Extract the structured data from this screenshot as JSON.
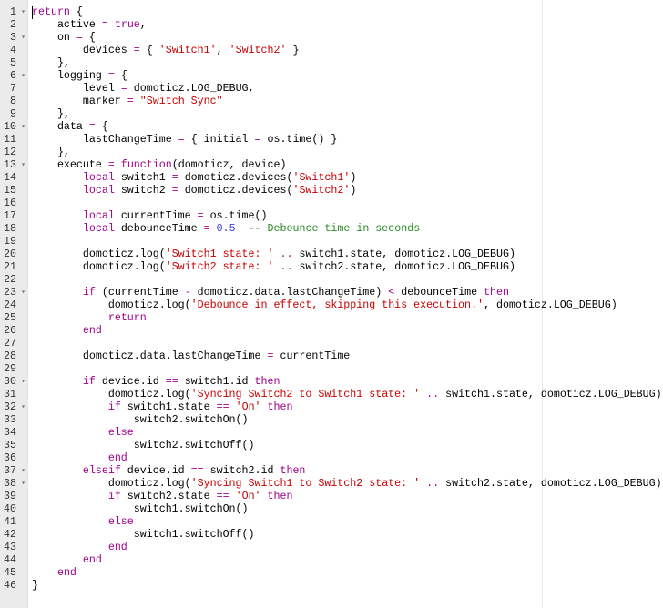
{
  "editor": {
    "accent_colors": {
      "keyword": "#a0008c",
      "string": "#c80000",
      "comment": "#2a8a24",
      "number": "#3c3ccf"
    },
    "fold_icon": "caret-down-icon",
    "fold_lines": [
      1,
      3,
      6,
      10,
      13,
      23,
      30,
      32,
      37,
      38
    ],
    "lines": [
      [
        [
          "k",
          "return"
        ],
        [
          "p",
          " {"
        ]
      ],
      [
        [
          "p",
          "    active "
        ],
        [
          "o",
          "="
        ],
        [
          "p",
          " "
        ],
        [
          "k",
          "true"
        ],
        [
          "p",
          ","
        ]
      ],
      [
        [
          "p",
          "    on "
        ],
        [
          "o",
          "="
        ],
        [
          "p",
          " {"
        ]
      ],
      [
        [
          "p",
          "        devices "
        ],
        [
          "o",
          "="
        ],
        [
          "p",
          " { "
        ],
        [
          "s",
          "'Switch1'"
        ],
        [
          "p",
          ", "
        ],
        [
          "s",
          "'Switch2'"
        ],
        [
          "p",
          " }"
        ]
      ],
      [
        [
          "p",
          "    },"
        ]
      ],
      [
        [
          "p",
          "    logging "
        ],
        [
          "o",
          "="
        ],
        [
          "p",
          " {"
        ]
      ],
      [
        [
          "p",
          "        level "
        ],
        [
          "o",
          "="
        ],
        [
          "p",
          " domoticz.LOG_DEBUG,"
        ]
      ],
      [
        [
          "p",
          "        marker "
        ],
        [
          "o",
          "="
        ],
        [
          "p",
          " "
        ],
        [
          "s",
          "\"Switch Sync\""
        ]
      ],
      [
        [
          "p",
          "    },"
        ]
      ],
      [
        [
          "p",
          "    data "
        ],
        [
          "o",
          "="
        ],
        [
          "p",
          " {"
        ]
      ],
      [
        [
          "p",
          "        lastChangeTime "
        ],
        [
          "o",
          "="
        ],
        [
          "p",
          " { initial "
        ],
        [
          "o",
          "="
        ],
        [
          "p",
          " os.time() }"
        ]
      ],
      [
        [
          "p",
          "    },"
        ]
      ],
      [
        [
          "p",
          "    execute "
        ],
        [
          "o",
          "="
        ],
        [
          "p",
          " "
        ],
        [
          "k",
          "function"
        ],
        [
          "p",
          "(domoticz, device)"
        ]
      ],
      [
        [
          "p",
          "        "
        ],
        [
          "k",
          "local"
        ],
        [
          "p",
          " switch1 "
        ],
        [
          "o",
          "="
        ],
        [
          "p",
          " domoticz.devices("
        ],
        [
          "s",
          "'Switch1'"
        ],
        [
          "p",
          ")"
        ]
      ],
      [
        [
          "p",
          "        "
        ],
        [
          "k",
          "local"
        ],
        [
          "p",
          " switch2 "
        ],
        [
          "o",
          "="
        ],
        [
          "p",
          " domoticz.devices("
        ],
        [
          "s",
          "'Switch2'"
        ],
        [
          "p",
          ")"
        ]
      ],
      [
        [
          "p",
          ""
        ]
      ],
      [
        [
          "p",
          "        "
        ],
        [
          "k",
          "local"
        ],
        [
          "p",
          " currentTime "
        ],
        [
          "o",
          "="
        ],
        [
          "p",
          " os.time()"
        ]
      ],
      [
        [
          "p",
          "        "
        ],
        [
          "k",
          "local"
        ],
        [
          "p",
          " debounceTime "
        ],
        [
          "o",
          "="
        ],
        [
          "p",
          " "
        ],
        [
          "n",
          "0.5"
        ],
        [
          "p",
          "  "
        ],
        [
          "c",
          "-- Debounce time in seconds"
        ]
      ],
      [
        [
          "p",
          ""
        ]
      ],
      [
        [
          "p",
          "        domoticz.log("
        ],
        [
          "s",
          "'Switch1 state: '"
        ],
        [
          "p",
          " "
        ],
        [
          "o",
          ".."
        ],
        [
          "p",
          " switch1.state, domoticz.LOG_DEBUG)"
        ]
      ],
      [
        [
          "p",
          "        domoticz.log("
        ],
        [
          "s",
          "'Switch2 state: '"
        ],
        [
          "p",
          " "
        ],
        [
          "o",
          ".."
        ],
        [
          "p",
          " switch2.state, domoticz.LOG_DEBUG)"
        ]
      ],
      [
        [
          "p",
          ""
        ]
      ],
      [
        [
          "p",
          "        "
        ],
        [
          "k",
          "if"
        ],
        [
          "p",
          " (currentTime "
        ],
        [
          "o",
          "-"
        ],
        [
          "p",
          " domoticz.data.lastChangeTime) "
        ],
        [
          "o",
          "<"
        ],
        [
          "p",
          " debounceTime "
        ],
        [
          "k",
          "then"
        ]
      ],
      [
        [
          "p",
          "            domoticz.log("
        ],
        [
          "s",
          "'Debounce in effect, skipping this execution.'"
        ],
        [
          "p",
          ", domoticz.LOG_DEBUG)"
        ]
      ],
      [
        [
          "p",
          "            "
        ],
        [
          "k",
          "return"
        ]
      ],
      [
        [
          "p",
          "        "
        ],
        [
          "k",
          "end"
        ]
      ],
      [
        [
          "p",
          ""
        ]
      ],
      [
        [
          "p",
          "        domoticz.data.lastChangeTime "
        ],
        [
          "o",
          "="
        ],
        [
          "p",
          " currentTime"
        ]
      ],
      [
        [
          "p",
          ""
        ]
      ],
      [
        [
          "p",
          "        "
        ],
        [
          "k",
          "if"
        ],
        [
          "p",
          " device.id "
        ],
        [
          "o",
          "=="
        ],
        [
          "p",
          " switch1.id "
        ],
        [
          "k",
          "then"
        ]
      ],
      [
        [
          "p",
          "            domoticz.log("
        ],
        [
          "s",
          "'Syncing Switch2 to Switch1 state: '"
        ],
        [
          "p",
          " "
        ],
        [
          "o",
          ".."
        ],
        [
          "p",
          " switch1.state, domoticz.LOG_DEBUG)"
        ]
      ],
      [
        [
          "p",
          "            "
        ],
        [
          "k",
          "if"
        ],
        [
          "p",
          " switch1.state "
        ],
        [
          "o",
          "=="
        ],
        [
          "p",
          " "
        ],
        [
          "s",
          "'On'"
        ],
        [
          "p",
          " "
        ],
        [
          "k",
          "then"
        ]
      ],
      [
        [
          "p",
          "                switch2.switchOn()"
        ]
      ],
      [
        [
          "p",
          "            "
        ],
        [
          "k",
          "else"
        ]
      ],
      [
        [
          "p",
          "                switch2.switchOff()"
        ]
      ],
      [
        [
          "p",
          "            "
        ],
        [
          "k",
          "end"
        ]
      ],
      [
        [
          "p",
          "        "
        ],
        [
          "k",
          "elseif"
        ],
        [
          "p",
          " device.id "
        ],
        [
          "o",
          "=="
        ],
        [
          "p",
          " switch2.id "
        ],
        [
          "k",
          "then"
        ]
      ],
      [
        [
          "p",
          "            domoticz.log("
        ],
        [
          "s",
          "'Syncing Switch1 to Switch2 state: '"
        ],
        [
          "p",
          " "
        ],
        [
          "o",
          ".."
        ],
        [
          "p",
          " switch2.state, domoticz.LOG_DEBUG)"
        ]
      ],
      [
        [
          "p",
          "            "
        ],
        [
          "k",
          "if"
        ],
        [
          "p",
          " switch2.state "
        ],
        [
          "o",
          "=="
        ],
        [
          "p",
          " "
        ],
        [
          "s",
          "'On'"
        ],
        [
          "p",
          " "
        ],
        [
          "k",
          "then"
        ]
      ],
      [
        [
          "p",
          "                switch1.switchOn()"
        ]
      ],
      [
        [
          "p",
          "            "
        ],
        [
          "k",
          "else"
        ]
      ],
      [
        [
          "p",
          "                switch1.switchOff()"
        ]
      ],
      [
        [
          "p",
          "            "
        ],
        [
          "k",
          "end"
        ]
      ],
      [
        [
          "p",
          "        "
        ],
        [
          "k",
          "end"
        ]
      ],
      [
        [
          "p",
          "    "
        ],
        [
          "k",
          "end"
        ]
      ],
      [
        [
          "p",
          "}"
        ]
      ]
    ]
  }
}
